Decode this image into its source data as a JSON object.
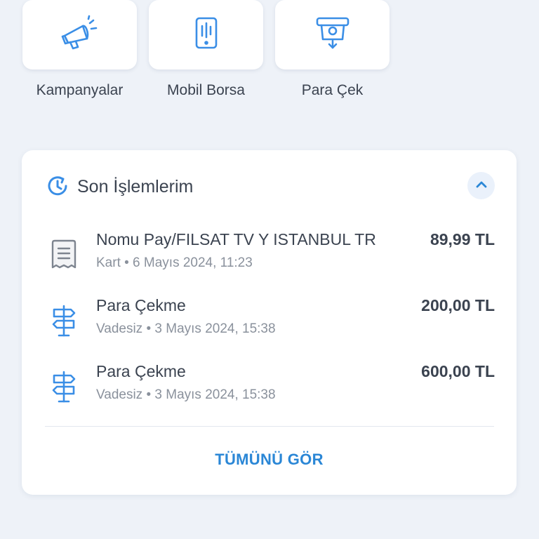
{
  "shortcuts": [
    {
      "label": "Kampanyalar",
      "icon": "megaphone-icon"
    },
    {
      "label": "Mobil Borsa",
      "icon": "mobile-stock-icon"
    },
    {
      "label": "Para Çek",
      "icon": "atm-withdraw-icon"
    }
  ],
  "recent": {
    "title": "Son İşlemlerim",
    "icon": "history-icon",
    "collapse_icon": "chevron-up-icon",
    "transactions": [
      {
        "name": "Nomu Pay/FILSAT TV Y ISTANBUL TR",
        "sub": "Kart • 6 Mayıs 2024, 11:23",
        "amount": "89,99 TL",
        "icon": "receipt-icon"
      },
      {
        "name": "Para Çekme",
        "sub": "Vadesiz • 3 Mayıs 2024, 15:38",
        "amount": "200,00 TL",
        "icon": "signpost-icon"
      },
      {
        "name": "Para Çekme",
        "sub": "Vadesiz • 3 Mayıs 2024, 15:38",
        "amount": "600,00 TL",
        "icon": "signpost-icon"
      }
    ],
    "see_all": "TÜMÜNÜ GÖR"
  },
  "colors": {
    "accent": "#2b87d6",
    "icon": "#3a8ee6",
    "background": "#eef2f8",
    "text": "#3b4350",
    "muted": "#8a919c"
  }
}
